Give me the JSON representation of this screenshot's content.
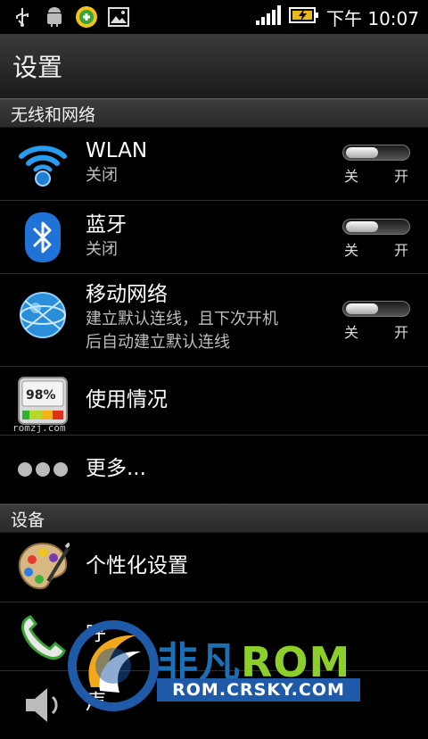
{
  "status_bar": {
    "left_icons": [
      "usb-icon",
      "android-debug-icon",
      "app-notification-icon",
      "image-icon"
    ],
    "right_icons": [
      "signal-icon",
      "battery-charging-icon"
    ],
    "time": "下午 10:07"
  },
  "header": {
    "title": "设置"
  },
  "sections": {
    "wireless": {
      "label": "无线和网络"
    },
    "device": {
      "label": "设备"
    }
  },
  "rows": {
    "wlan": {
      "label": "WLAN",
      "sub": "关闭",
      "icon": "wifi-icon",
      "toggle": {
        "off": "关",
        "on": "开",
        "state": "off"
      }
    },
    "bluetooth": {
      "label": "蓝牙",
      "sub": "关闭",
      "icon": "bluetooth-icon",
      "toggle": {
        "off": "关",
        "on": "开",
        "state": "off"
      }
    },
    "mobile": {
      "label": "移动网络",
      "sub_line1": "建立默认连线，且下次开机",
      "sub_line2": "后自动建立默认连线",
      "icon": "globe-icon",
      "toggle": {
        "off": "关",
        "on": "开",
        "state": "off"
      }
    },
    "usage": {
      "label": "使用情况",
      "icon": "gauge-icon",
      "gauge_text": "98%"
    },
    "more": {
      "label": "更多...",
      "icon": "more-dots-icon"
    },
    "personalize": {
      "label": "个性化设置",
      "icon": "palette-icon"
    },
    "call": {
      "label": "呼",
      "icon": "phone-icon"
    },
    "sound": {
      "label": "声",
      "icon": "speaker-icon"
    }
  },
  "watermarks": {
    "small": "romzj.com",
    "brand_cn": "非凡",
    "brand_rom": "ROM",
    "url": "ROM.CRSKY.COM"
  },
  "colors": {
    "wifi_blue": "#2a9cf0",
    "watermark_blue": "#1e5aa8",
    "watermark_green": "#8ccf2a"
  }
}
